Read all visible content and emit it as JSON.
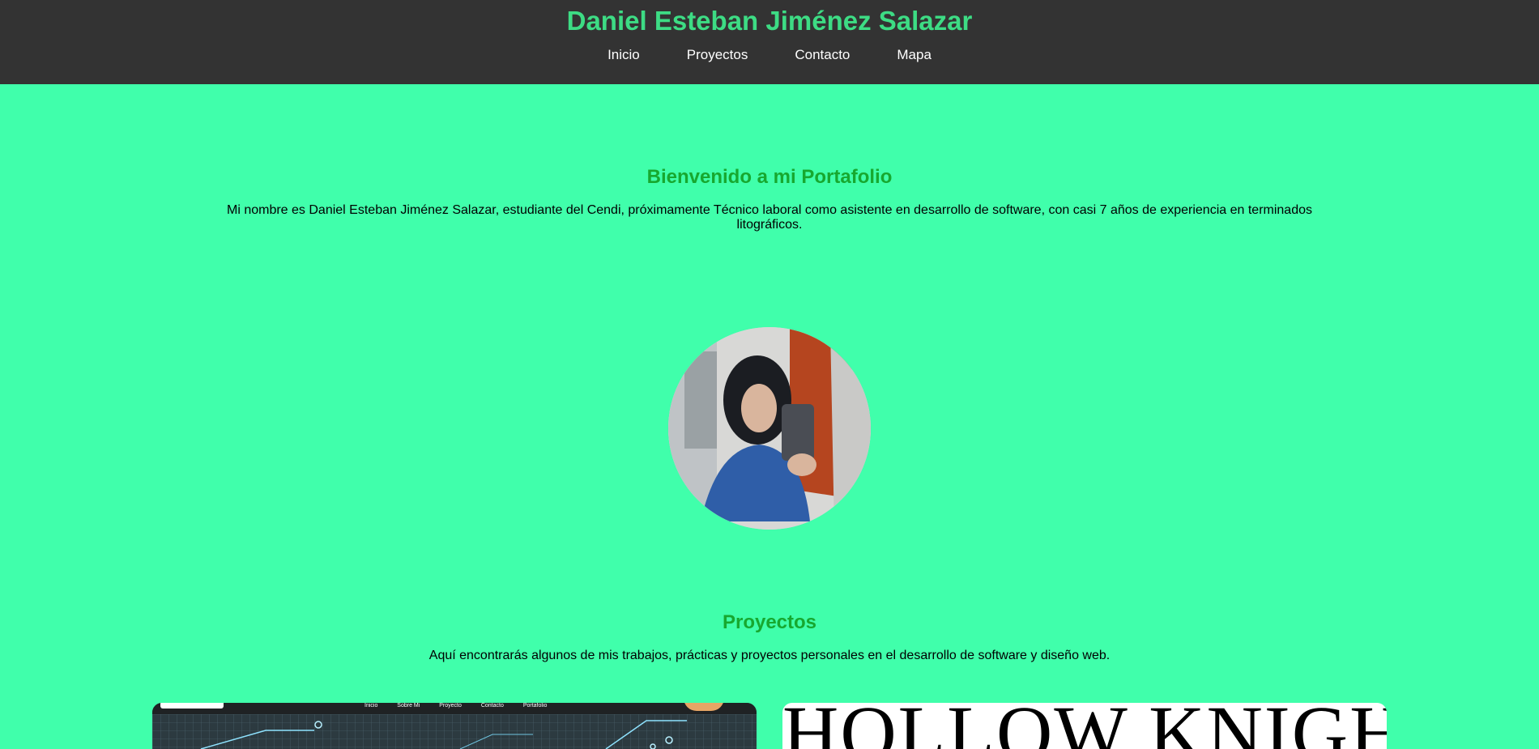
{
  "header": {
    "site_title": "Daniel Esteban Jiménez Salazar",
    "nav": {
      "inicio": "Inicio",
      "proyectos": "Proyectos",
      "contacto": "Contacto",
      "mapa": "Mapa"
    }
  },
  "welcome": {
    "title": "Bienvenido a mi Portafolio",
    "text": "Mi nombre es Daniel Esteban Jiménez Salazar, estudiante del Cendi, próximamente Técnico laboral como asistente en desarrollo de software, con casi 7 años de experiencia en terminados litográficos."
  },
  "projects": {
    "title": "Proyectos",
    "text": "Aquí encontrarás algunos de mis trabajos, prácticas y proyectos personales en el desarrollo de software y diseño web.",
    "card1": {
      "mini_nav": [
        "Inicio",
        "Sobre Mi",
        "Proyecto",
        "Contacto",
        "Portafolio"
      ]
    },
    "card2": {
      "title": "HOLLOW KNIGHT"
    }
  },
  "colors": {
    "background": "#40ffab",
    "header": "#333333",
    "accent": "#3ddc84",
    "heading": "#17a82f"
  }
}
